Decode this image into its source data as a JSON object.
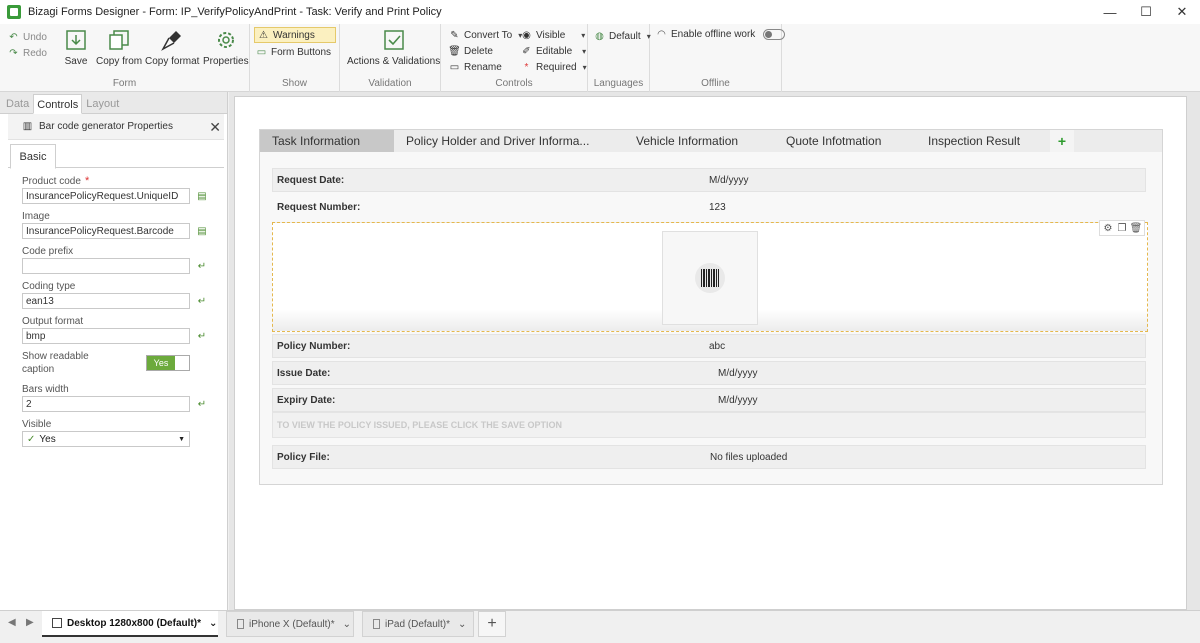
{
  "window": {
    "title": "Bizagi Forms Designer  -  Form: IP_VerifyPolicyAndPrint  -  Task:  Verify and Print Policy",
    "minimize": "—",
    "maximize": "☐",
    "close": "✕"
  },
  "ribbon": {
    "undo": "Undo",
    "redo": "Redo",
    "save": "Save",
    "copy_from": "Copy from",
    "copy_format": "Copy format",
    "properties": "Properties",
    "group_form": "Form",
    "warnings": "Warnings",
    "form_buttons": "Form Buttons",
    "group_show": "Show",
    "actions_validations": "Actions & Validations",
    "group_validation": "Validation",
    "convert_to": "Convert To",
    "delete": "Delete",
    "rename": "Rename",
    "visible": "Visible",
    "editable": "Editable",
    "required": "Required",
    "group_controls": "Controls",
    "default_lang": "Default",
    "group_languages": "Languages",
    "enable_offline": "Enable offline work",
    "group_offline": "Offline"
  },
  "left_panel": {
    "tabs": [
      "Data",
      "Controls",
      "Layout"
    ],
    "active_tab": "Controls",
    "header_title": "Bar code generator Properties",
    "basic_tab": "Basic",
    "fields": {
      "product_code": {
        "label": "Product code",
        "value": "InsurancePolicyRequest.UniqueID"
      },
      "image": {
        "label": "Image",
        "value": "InsurancePolicyRequest.Barcode"
      },
      "code_prefix": {
        "label": "Code prefix",
        "value": ""
      },
      "coding_type": {
        "label": "Coding type",
        "value": "ean13"
      },
      "output_format": {
        "label": "Output format",
        "value": "bmp"
      },
      "show_readable_caption": {
        "label_line1": "Show readable",
        "label_line2": "caption",
        "value": "Yes"
      },
      "bars_width": {
        "label": "Bars width",
        "value": "2"
      },
      "visible": {
        "label": "Visible",
        "value": "Yes"
      }
    }
  },
  "form": {
    "tabs": [
      "Task Information",
      "Policy Holder and Driver Informa...",
      "Vehicle Information",
      "Quote Infotmation",
      "Inspection Result"
    ],
    "active_tab": "Task Information",
    "rows": {
      "request_date": {
        "label": "Request Date:",
        "value": "M/d/yyyy"
      },
      "request_number": {
        "label": "Request Number:",
        "value": "123"
      },
      "policy_number": {
        "label": "Policy Number:",
        "value": "abc"
      },
      "issue_date": {
        "label": "Issue Date:",
        "value": "M/d/yyyy"
      },
      "expiry_date": {
        "label": "Expiry Date:",
        "value": "M/d/yyyy"
      },
      "policy_file": {
        "label": "Policy File:",
        "value": "No files uploaded"
      }
    },
    "note": "TO VIEW THE POLICY ISSUED, PLEASE CLICK THE SAVE OPTION"
  },
  "devices": {
    "desktop": "Desktop 1280x800 (Default)",
    "iphone": "iPhone X (Default)",
    "ipad": "iPad (Default)",
    "modified_mark": "*",
    "add": "+"
  }
}
